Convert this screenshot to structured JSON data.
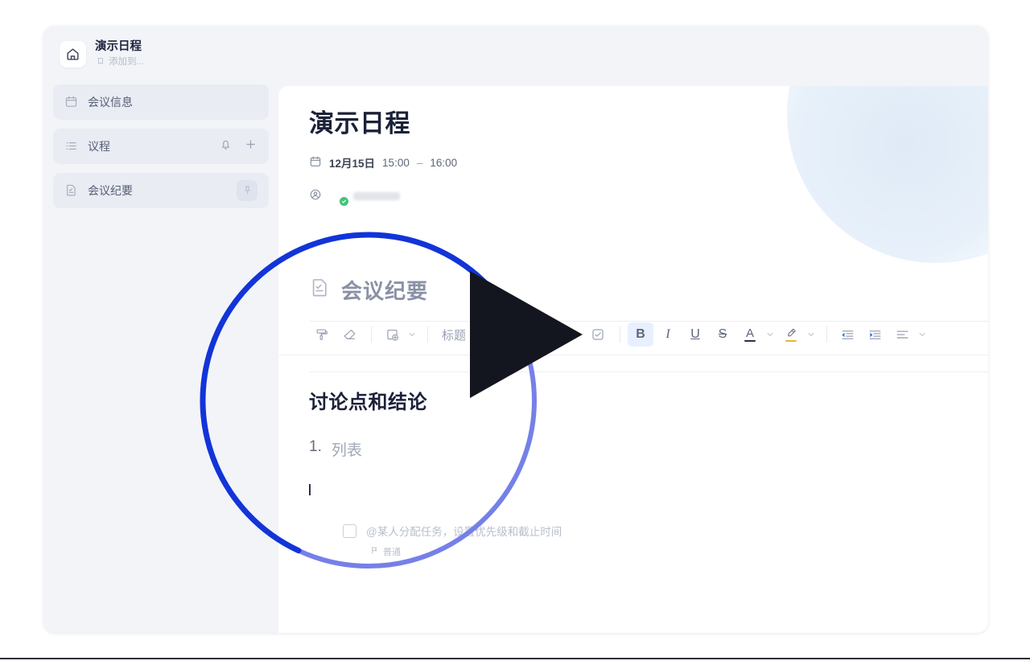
{
  "sidebar": {
    "home": {
      "icon": "home-icon",
      "title": "演示日程",
      "sub_icon": "add-to-icon",
      "sub_label": "添加到..."
    },
    "items": [
      {
        "icon": "calendar-icon",
        "label": "会议信息",
        "actions": []
      },
      {
        "icon": "list-icon",
        "label": "议程",
        "actions": [
          "bell-icon",
          "plus-icon"
        ]
      },
      {
        "icon": "minutes-doc-icon",
        "label": "会议纪要",
        "actions": [
          "pin-icon"
        ]
      }
    ]
  },
  "document": {
    "title": "演示日程",
    "meta": {
      "calendar_icon": "calendar-icon",
      "date": "12月15日",
      "time_start": "15:00",
      "dash": "–",
      "time_end": "16:00",
      "person_icon": "person-icon",
      "attendee_name": "",
      "attendee_badge": "verified-check-icon"
    }
  },
  "minutes": {
    "icon": "minutes-doc-icon",
    "title": "会议纪要",
    "toolbar": {
      "groups": [
        {
          "items": [
            {
              "name": "format-painter-icon",
              "label": "",
              "caret": false,
              "active": false
            },
            {
              "name": "clear-format-icon",
              "label": "",
              "caret": false,
              "active": false
            }
          ]
        },
        {
          "items": [
            {
              "name": "insert-media-icon",
              "label": "",
              "caret": true,
              "active": false
            }
          ]
        },
        {
          "items": [
            {
              "name": "heading-style-select",
              "label": "标题",
              "caret": true,
              "active": false
            }
          ]
        },
        {
          "items": [
            {
              "name": "bulleted-list-icon",
              "label": "",
              "caret": true,
              "active": false
            },
            {
              "name": "numbered-list-icon",
              "label": "",
              "caret": true,
              "active": false
            },
            {
              "name": "checklist-icon",
              "label": "",
              "caret": false,
              "active": false
            }
          ]
        },
        {
          "items": [
            {
              "name": "bold-button",
              "label": "B",
              "caret": false,
              "active": true
            },
            {
              "name": "italic-button",
              "label": "I",
              "caret": false,
              "active": false
            },
            {
              "name": "underline-button",
              "label": "U",
              "caret": false,
              "active": false
            },
            {
              "name": "strikethrough-button",
              "label": "S",
              "caret": false,
              "active": false
            },
            {
              "name": "text-color-button",
              "label": "A",
              "caret": true,
              "active": false
            },
            {
              "name": "highlight-color-button",
              "label": "",
              "caret": true,
              "active": false
            }
          ]
        },
        {
          "items": [
            {
              "name": "outdent-button",
              "label": "",
              "caret": false,
              "active": false
            },
            {
              "name": "indent-button",
              "label": "",
              "caret": false,
              "active": false
            },
            {
              "name": "align-button",
              "label": "",
              "caret": true,
              "active": false
            }
          ]
        }
      ]
    },
    "body": {
      "heading": "讨论点和结论",
      "list_number": "1.",
      "list_text": "列表",
      "todo_text": "@某人分配任务，设置优先级和截止时间",
      "todo_flag_icon": "flag-icon",
      "todo_flag_label": "普通"
    }
  },
  "overlay": {
    "play_icon": "play-triangle-icon",
    "ring": {
      "progress_color": "#1234d8",
      "track_color": "#7580e8",
      "progress_percent": 62
    }
  },
  "colors": {
    "app_bg": "#f2f4f8",
    "sidebar_item_bg": "#e9ecf3",
    "accent_blue": "#1234d8",
    "accent_light": "#7580e8",
    "text_dark": "#1b2138",
    "text_muted": "#9aa1b3"
  }
}
